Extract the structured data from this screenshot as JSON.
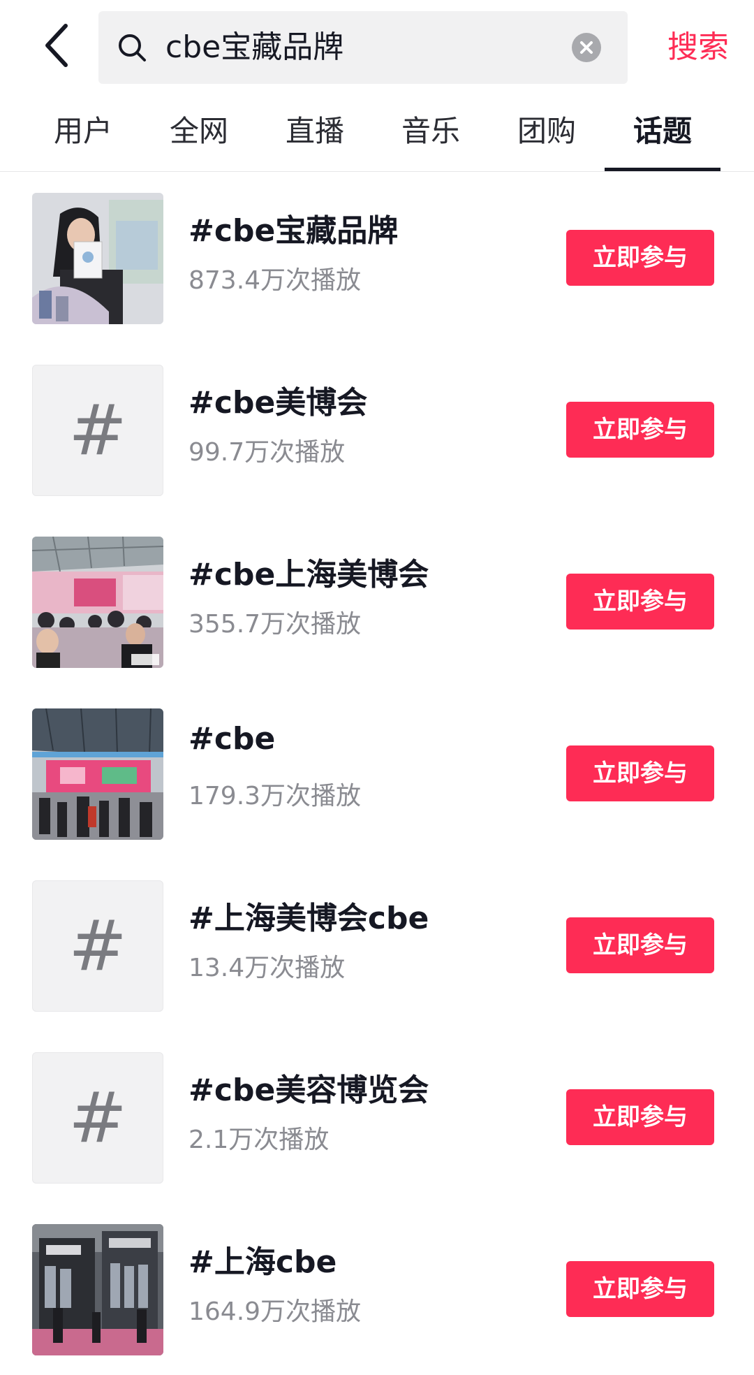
{
  "search": {
    "query": "cbe宝藏品牌",
    "submit_label": "搜索"
  },
  "tabs": [
    {
      "label": "用户"
    },
    {
      "label": "全网"
    },
    {
      "label": "直播"
    },
    {
      "label": "音乐"
    },
    {
      "label": "团购"
    },
    {
      "label": "话题",
      "active": true
    }
  ],
  "topics": [
    {
      "title": "#cbe宝藏品牌",
      "plays": "873.4万次播放",
      "thumb": "photo",
      "button": "立即参与"
    },
    {
      "title": "#cbe美博会",
      "plays": "99.7万次播放",
      "thumb": "hash",
      "hash_symbol": "#",
      "button": "立即参与"
    },
    {
      "title": "#cbe上海美博会",
      "plays": "355.7万次播放",
      "thumb": "photo",
      "button": "立即参与"
    },
    {
      "title": "#cbe",
      "plays": "179.3万次播放",
      "thumb": "photo",
      "button": "立即参与"
    },
    {
      "title": "#上海美博会cbe",
      "plays": "13.4万次播放",
      "thumb": "hash",
      "hash_symbol": "#",
      "button": "立即参与"
    },
    {
      "title": "#cbe美容博览会",
      "plays": "2.1万次播放",
      "thumb": "hash",
      "hash_symbol": "#",
      "button": "立即参与"
    },
    {
      "title": "#上海cbe",
      "plays": "164.9万次播放",
      "thumb": "photo",
      "button": "立即参与"
    }
  ],
  "colors": {
    "accent": "#fe2c55",
    "text": "#161823",
    "muted": "#8a8b91",
    "search_bg": "#f1f1f2"
  }
}
